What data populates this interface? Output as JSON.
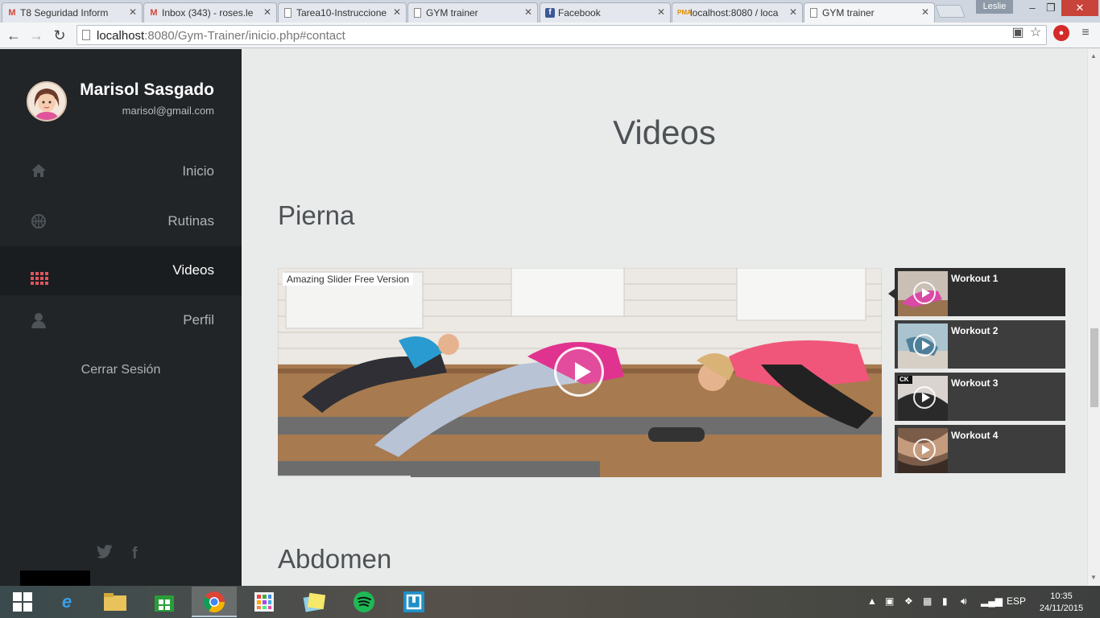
{
  "browser": {
    "tabs": [
      {
        "title": "T8 Seguridad Inform",
        "icon": "gmail-icon"
      },
      {
        "title": "Inbox (343) - roses.le",
        "icon": "gmail-icon"
      },
      {
        "title": "Tarea10-Instruccione",
        "icon": "document-icon"
      },
      {
        "title": "GYM trainer",
        "icon": "document-icon"
      },
      {
        "title": "Facebook",
        "icon": "facebook-icon"
      },
      {
        "title": "localhost:8080 / loca",
        "icon": "phpmyadmin-icon"
      },
      {
        "title": "GYM trainer",
        "icon": "document-icon"
      }
    ],
    "user": "Leslie",
    "url_host": "localhost",
    "url_rest": ":8080/Gym-Trainer/inicio.php#contact"
  },
  "sidebar": {
    "name": "Marisol Sasgado",
    "email": "marisol@gmail.com",
    "items": [
      {
        "label": "Inicio",
        "icon": "home-icon"
      },
      {
        "label": "Rutinas",
        "icon": "basketball-icon"
      },
      {
        "label": "Videos",
        "icon": "grid-icon"
      },
      {
        "label": "Perfil",
        "icon": "user-icon"
      }
    ],
    "logout": "Cerrar Sesión",
    "accent": "#e0555f"
  },
  "main": {
    "title": "Videos",
    "sections": [
      "Pierna",
      "Abdomen"
    ],
    "slider_badge": "Amazing Slider Free Version",
    "playlist": [
      "Workout 1",
      "Workout 2",
      "Workout 3",
      "Workout 4"
    ],
    "thumb3_tag": "CK"
  },
  "taskbar": {
    "lang": "ESP",
    "time": "10:35",
    "date": "24/11/2015"
  }
}
